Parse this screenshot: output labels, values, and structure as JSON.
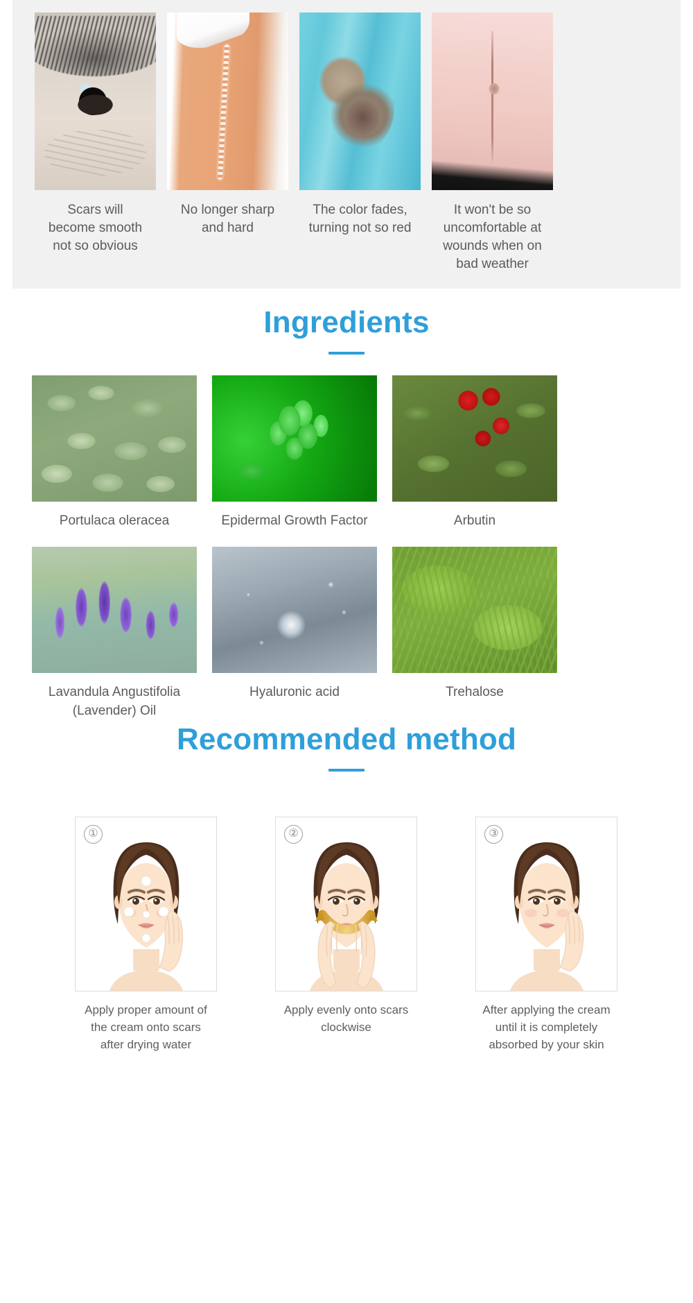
{
  "theme": {
    "accent": "#2f9fd9",
    "panel_bg": "#f1f1f1",
    "page_bg": "#ffffff",
    "text": "#5b5b5b"
  },
  "benefits": {
    "items": [
      {
        "image": "eye-scar-photo",
        "caption": "Scars will\nbecome smooth\nnot so obvious"
      },
      {
        "image": "arm-scar-photo",
        "caption": "No longer sharp\nand hard"
      },
      {
        "image": "foot-scar-photo",
        "caption": "The color fades,\nturning not so red"
      },
      {
        "image": "abdomen-scar-photo",
        "caption": "It won't be so\nuncomfortable at\nwounds when on\nbad weather"
      }
    ]
  },
  "ingredients": {
    "title": "Ingredients",
    "items": [
      {
        "image": "purslane-photo",
        "label": "Portulaca oleracea"
      },
      {
        "image": "egf-cells-photo",
        "label": "Epidermal Growth Factor"
      },
      {
        "image": "bearberry-photo",
        "label": "Arbutin"
      },
      {
        "image": "lavender-photo",
        "label": "Lavandula Angustifolia\n(Lavender) Oil"
      },
      {
        "image": "water-droplet-photo",
        "label": "Hyaluronic acid"
      },
      {
        "image": "fern-photo",
        "label": "Trehalose"
      }
    ]
  },
  "method": {
    "title": "Recommended method",
    "steps": [
      {
        "number": "①",
        "illustration": "face-dots-illustration",
        "caption": "Apply proper amount of\nthe cream onto scars\nafter drying water"
      },
      {
        "number": "②",
        "illustration": "face-spread-illustration",
        "caption": "Apply evenly onto scars\nclockwise"
      },
      {
        "number": "③",
        "illustration": "face-done-illustration",
        "caption": "After applying the cream\nuntil it is completely\nabsorbed by your skin"
      }
    ]
  }
}
